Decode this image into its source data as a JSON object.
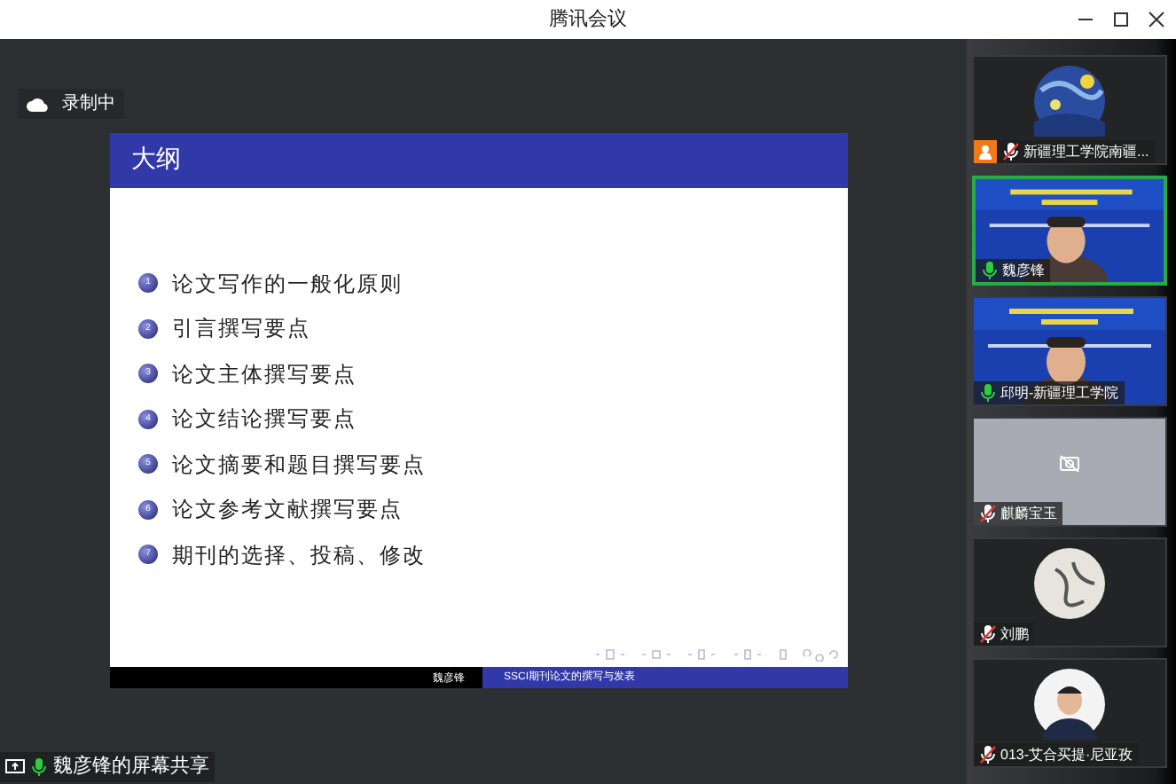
{
  "window": {
    "title": "腾讯会议"
  },
  "recording": {
    "label": "录制中"
  },
  "slide": {
    "title": "大纲",
    "items": [
      {
        "num": "1",
        "text": "论文写作的一般化原则"
      },
      {
        "num": "2",
        "text": "引言撰写要点"
      },
      {
        "num": "3",
        "text": "论文主体撰写要点"
      },
      {
        "num": "4",
        "text": "论文结论撰写要点"
      },
      {
        "num": "5",
        "text": "论文摘要和题目撰写要点"
      },
      {
        "num": "6",
        "text": "论文参考文献撰写要点"
      },
      {
        "num": "7",
        "text": "期刊的选择、投稿、修改"
      }
    ],
    "footer_author": "魏彦锋",
    "footer_title": "SSCI期刊论文的撰写与发表"
  },
  "share_label": {
    "text": "魏彦锋的屏幕共享",
    "muted": false
  },
  "participants": [
    {
      "name": "新疆理工学院南疆...",
      "kind": "avatar",
      "muted": true,
      "speaking": false,
      "host_badge": true
    },
    {
      "name": "魏彦锋",
      "kind": "video",
      "muted": false,
      "speaking": true,
      "host_badge": false
    },
    {
      "name": "邱明-新疆理工学院",
      "kind": "video",
      "muted": false,
      "speaking": false,
      "host_badge": false
    },
    {
      "name": "麒麟宝玉",
      "kind": "camera_off",
      "muted": true,
      "speaking": false,
      "host_badge": false
    },
    {
      "name": "刘鹏",
      "kind": "avatar",
      "muted": true,
      "speaking": false,
      "host_badge": false
    },
    {
      "name": "013-艾合买提·尼亚孜",
      "kind": "avatar",
      "muted": true,
      "speaking": false,
      "host_badge": false
    }
  ]
}
